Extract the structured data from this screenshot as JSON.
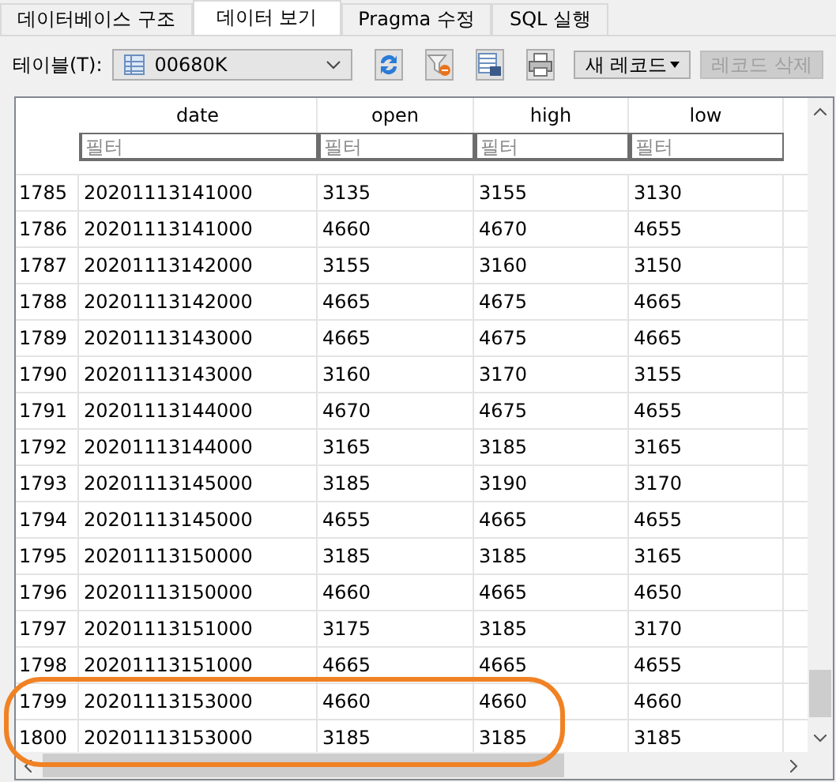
{
  "tabs": [
    {
      "label": "데이터베이스 구조",
      "selected": false
    },
    {
      "label": "데이터 보기",
      "selected": true
    },
    {
      "label": "Pragma 수정",
      "selected": false
    },
    {
      "label": "SQL 실행",
      "selected": false
    }
  ],
  "toolbar": {
    "table_label": "테이블(T):",
    "table_value": "00680K",
    "new_record": "새 레코드",
    "delete_record": "레코드 삭제",
    "delete_disabled": true
  },
  "table": {
    "columns": [
      "date",
      "open",
      "high",
      "low"
    ],
    "filters": [
      {
        "placeholder": "필터"
      },
      {
        "placeholder": "필터"
      },
      {
        "placeholder": "필터"
      },
      {
        "placeholder": "필터"
      }
    ],
    "rows": [
      {
        "num": "1785",
        "cells": [
          "20201113141000",
          "3135",
          "3155",
          "3130"
        ],
        "circled": false
      },
      {
        "num": "1786",
        "cells": [
          "20201113141000",
          "4660",
          "4670",
          "4655"
        ],
        "circled": false
      },
      {
        "num": "1787",
        "cells": [
          "20201113142000",
          "3155",
          "3160",
          "3150"
        ],
        "circled": false
      },
      {
        "num": "1788",
        "cells": [
          "20201113142000",
          "4665",
          "4675",
          "4665"
        ],
        "circled": false
      },
      {
        "num": "1789",
        "cells": [
          "20201113143000",
          "4665",
          "4675",
          "4665"
        ],
        "circled": false
      },
      {
        "num": "1790",
        "cells": [
          "20201113143000",
          "3160",
          "3170",
          "3155"
        ],
        "circled": false
      },
      {
        "num": "1791",
        "cells": [
          "20201113144000",
          "4670",
          "4675",
          "4655"
        ],
        "circled": false
      },
      {
        "num": "1792",
        "cells": [
          "20201113144000",
          "3165",
          "3185",
          "3165"
        ],
        "circled": false
      },
      {
        "num": "1793",
        "cells": [
          "20201113145000",
          "3185",
          "3190",
          "3170"
        ],
        "circled": false
      },
      {
        "num": "1794",
        "cells": [
          "20201113145000",
          "4655",
          "4665",
          "4655"
        ],
        "circled": false
      },
      {
        "num": "1795",
        "cells": [
          "20201113150000",
          "3185",
          "3185",
          "3165"
        ],
        "circled": false
      },
      {
        "num": "1796",
        "cells": [
          "20201113150000",
          "4660",
          "4665",
          "4650"
        ],
        "circled": false
      },
      {
        "num": "1797",
        "cells": [
          "20201113151000",
          "3175",
          "3185",
          "3170"
        ],
        "circled": false
      },
      {
        "num": "1798",
        "cells": [
          "20201113151000",
          "4665",
          "4665",
          "4655"
        ],
        "circled": false
      },
      {
        "num": "1799",
        "cells": [
          "20201113153000",
          "4660",
          "4660",
          "4660"
        ],
        "circled": true
      },
      {
        "num": "1800",
        "cells": [
          "20201113153000",
          "3185",
          "3185",
          "3185"
        ],
        "circled": true
      }
    ]
  }
}
